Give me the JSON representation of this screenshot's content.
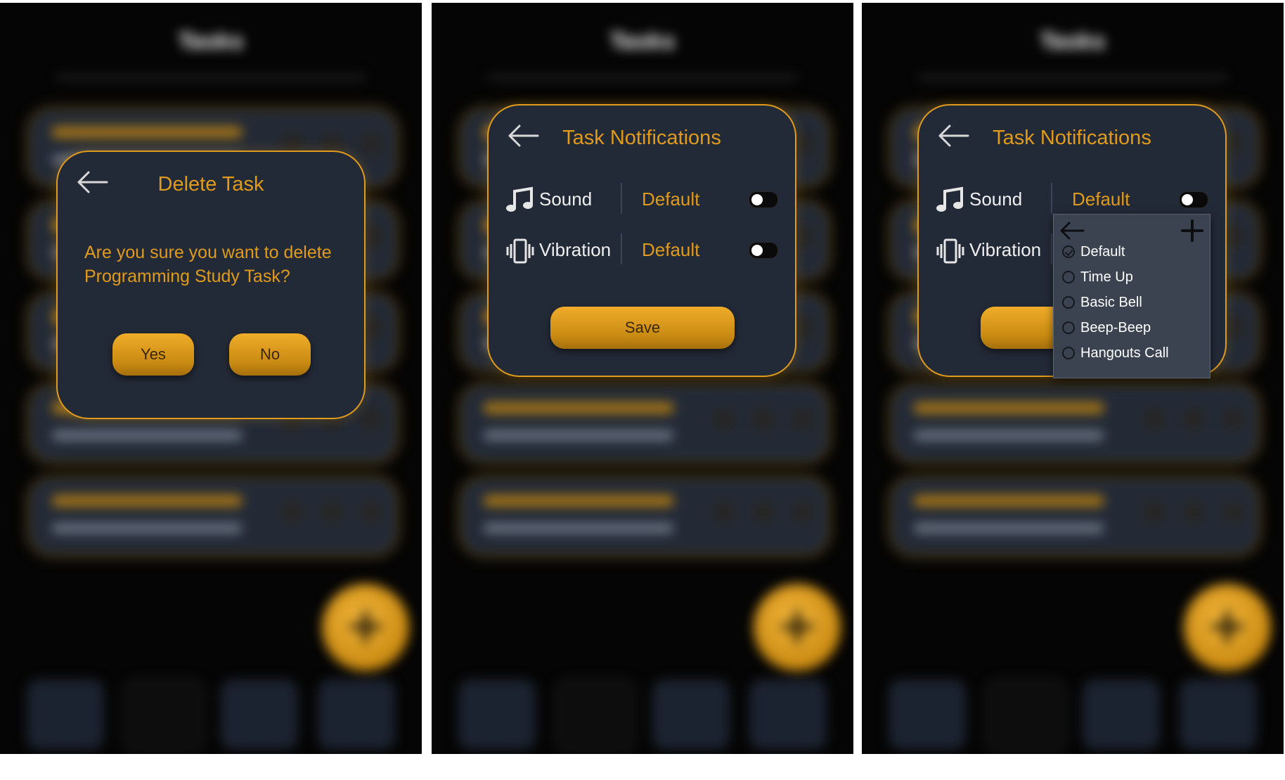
{
  "background_app": {
    "title": "Tasks"
  },
  "colors": {
    "accent": "#e09a1c",
    "dialog_bg": "#232a37",
    "screen_bg": "#050505"
  },
  "icons": {
    "back": "arrow-left-icon",
    "sound": "music-note-icon",
    "vibration": "vibration-icon",
    "add": "plus-icon",
    "fab": "plus-icon"
  },
  "delete_dialog": {
    "title": "Delete Task",
    "message": "Are you sure you want to delete Programming Study Task?",
    "yes_label": "Yes",
    "no_label": "No"
  },
  "notifications_dialog": {
    "title": "Task Notifications",
    "sound_label": "Sound",
    "sound_value": "Default",
    "vibration_label": "Vibration",
    "vibration_value": "Default",
    "save_label": "Save"
  },
  "sound_picker": {
    "options": [
      "Default",
      "Time Up",
      "Basic Bell",
      "Beep-Beep",
      "Hangouts Call"
    ],
    "selected": "Default"
  }
}
